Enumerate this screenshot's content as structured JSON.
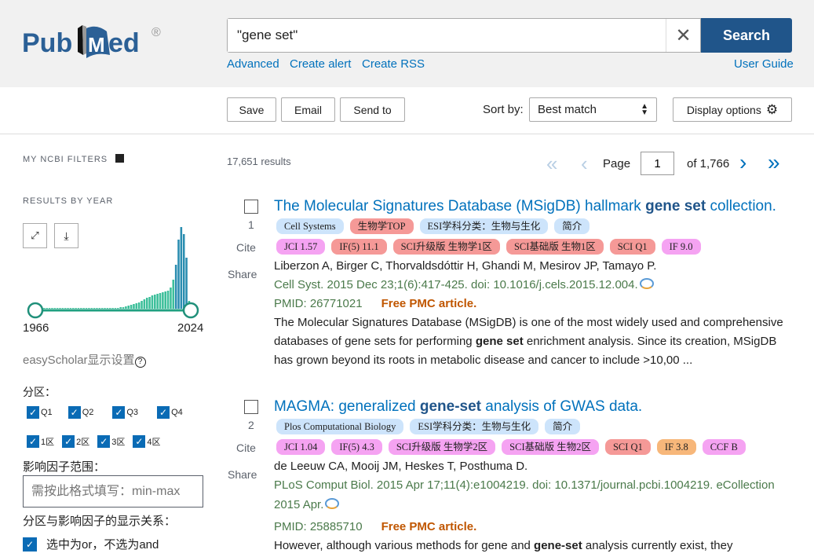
{
  "header": {
    "logo": "PubMed",
    "logo_mark": "®",
    "query": "\"gene set\"",
    "search_label": "Search",
    "links": [
      "Advanced",
      "Create alert",
      "Create RSS"
    ],
    "user_guide": "User Guide"
  },
  "toolbar": {
    "save": "Save",
    "email": "Email",
    "send_to": "Send to",
    "sort_by_label": "Sort by:",
    "sort_value": "Best match",
    "display_options": "Display options"
  },
  "results": {
    "count": "17,651 results",
    "page_label": "Page",
    "page": "1",
    "of_pages": "of 1,766"
  },
  "sidebar": {
    "my_ncbi_filters": "MY NCBI FILTERS",
    "results_by_year": "RESULTS BY YEAR",
    "year_start": "1966",
    "year_end": "2024",
    "year_counts_relative": [
      1,
      1,
      1,
      1,
      1,
      1,
      1,
      1,
      1,
      1,
      1,
      1,
      1,
      1,
      1,
      1,
      1,
      1,
      1,
      1,
      1,
      1,
      1,
      1,
      1,
      1,
      1,
      1,
      1,
      1,
      1,
      1,
      2,
      2,
      3,
      4,
      5,
      6,
      7,
      8,
      10,
      12,
      14,
      15,
      17,
      18,
      19,
      20,
      21,
      22,
      23,
      27,
      37,
      56,
      88,
      104,
      95,
      65,
      10
    ],
    "easyscholar": "easyScholar显示设置",
    "partition_label": "分区：",
    "q_options": [
      "Q1",
      "Q2",
      "Q3",
      "Q4"
    ],
    "zone_options": [
      "1区",
      "2区",
      "3区",
      "4区"
    ],
    "if_range_label": "影响因子范围：",
    "if_placeholder": "需按此格式填写：min-max",
    "relation_label": "分区与影响因子的显示关系：",
    "relation_option": "选中为or，不选为and"
  },
  "articles": [
    {
      "num": "1",
      "title_pre": "The Molecular Signatures Database (MSigDB) hallmark ",
      "title_bold": "gene set",
      "title_post": " collection.",
      "tags1": [
        {
          "t": "Cell Systems",
          "c": "blue"
        },
        {
          "t": "生物学TOP",
          "c": "red"
        },
        {
          "t": "ESI学科分类：生物与生化",
          "c": "blue"
        },
        {
          "t": "简介",
          "c": "blue"
        }
      ],
      "tags2": [
        {
          "t": "JCI 1.57",
          "c": "pink"
        },
        {
          "t": "IF(5) 11.1",
          "c": "red"
        },
        {
          "t": "SCI升级版 生物学1区",
          "c": "red"
        },
        {
          "t": "SCI基础版 生物1区",
          "c": "red"
        },
        {
          "t": "SCI Q1",
          "c": "red"
        },
        {
          "t": "IF 9.0",
          "c": "pink"
        }
      ],
      "authors": "Liberzon A, Birger C, Thorvaldsdóttir H, Ghandi M, Mesirov JP, Tamayo P.",
      "citation": "Cell Syst. 2015 Dec 23;1(6):417-425. doi: 10.1016/j.cels.2015.12.004.",
      "citation2": "",
      "pmid": "PMID: 26771021",
      "free": "Free PMC article.",
      "snippet": [
        "The Molecular Signatures Database (MSigDB) is one of the most widely used and comprehensive",
        "databases of gene sets for performing ",
        "gene set",
        " enrichment analysis. Since its creation, MSigDB",
        "has grown beyond its roots in metabolic disease and cancer to include >10,00 ..."
      ]
    },
    {
      "num": "2",
      "title_pre": "MAGMA: generalized ",
      "title_bold": "gene-set",
      "title_post": " analysis of GWAS data.",
      "tags1": [
        {
          "t": "Plos Computational Biology",
          "c": "blue"
        },
        {
          "t": "ESI学科分类：生物与生化",
          "c": "blue"
        },
        {
          "t": "简介",
          "c": "blue"
        }
      ],
      "tags2": [
        {
          "t": "JCI 1.04",
          "c": "pink"
        },
        {
          "t": "IF(5) 4.3",
          "c": "pink"
        },
        {
          "t": "SCI升级版 生物学2区",
          "c": "pink"
        },
        {
          "t": "SCI基础版 生物2区",
          "c": "pink"
        },
        {
          "t": "SCI Q1",
          "c": "red"
        },
        {
          "t": "IF 3.8",
          "c": "orange"
        },
        {
          "t": "CCF B",
          "c": "pink"
        }
      ],
      "authors": "de Leeuw CA, Mooij JM, Heskes T, Posthuma D.",
      "citation": "PLoS Comput Biol. 2015 Apr 17;11(4):e1004219. doi: 10.1371/journal.pcbi.1004219. eCollection",
      "citation2": "2015 Apr.",
      "pmid": "PMID: 25885710",
      "free": "Free PMC article.",
      "snippet": [
        "However, although various methods for gene and ",
        "gene-set",
        " analysis currently exist, they"
      ]
    }
  ],
  "actions": {
    "cite": "Cite",
    "share": "Share"
  }
}
